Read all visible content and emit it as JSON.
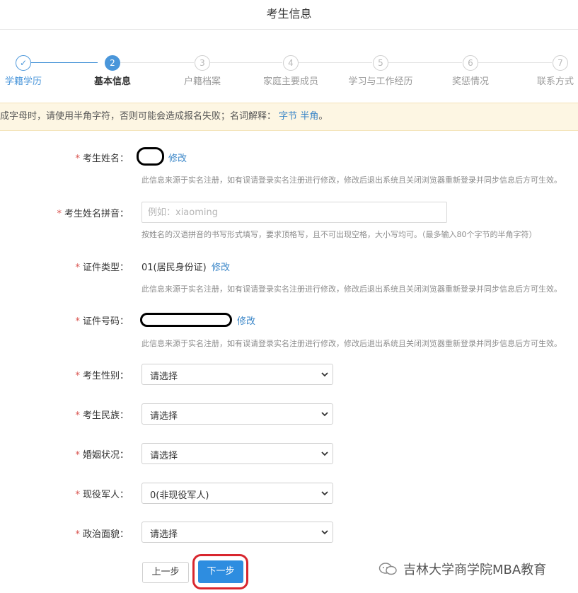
{
  "header": {
    "title": "考生信息"
  },
  "steps": [
    {
      "num": "✓",
      "label": "学籍学历",
      "state": "done"
    },
    {
      "num": "2",
      "label": "基本信息",
      "state": "active"
    },
    {
      "num": "3",
      "label": "户籍档案",
      "state": "todo"
    },
    {
      "num": "4",
      "label": "家庭主要成员",
      "state": "todo"
    },
    {
      "num": "5",
      "label": "学习与工作经历",
      "state": "todo"
    },
    {
      "num": "6",
      "label": "奖惩情况",
      "state": "todo"
    },
    {
      "num": "7",
      "label": "联系方式",
      "state": "todo"
    }
  ],
  "notice": {
    "text": "成字母时，请使用半角字符，否则可能会造成报名失败；名词解释：",
    "link1": "字节",
    "link2": "半角",
    "end": "。"
  },
  "form": {
    "required_mark": "*",
    "name": {
      "label": "考生姓名：",
      "edit": "修改",
      "hint": "此信息来源于实名注册，如有误请登录实名注册进行修改，修改后退出系统且关闭浏览器重新登录并同步信息后方可生效。"
    },
    "pinyin": {
      "label": "考生姓名拼音：",
      "placeholder": "例如：xiaoming",
      "hint": "按姓名的汉语拼音的书写形式填写，要求顶格写，且不可出现空格，大小写均可。（最多输入80个字节的半角字符）"
    },
    "id_type": {
      "label": "证件类型：",
      "value": "01(居民身份证)",
      "edit": "修改",
      "hint": "此信息来源于实名注册，如有误请登录实名注册进行修改，修改后退出系统且关闭浏览器重新登录并同步信息后方可生效。"
    },
    "id_number": {
      "label": "证件号码：",
      "edit": "修改",
      "hint": "此信息来源于实名注册，如有误请登录实名注册进行修改，修改后退出系统且关闭浏览器重新登录并同步信息后方可生效。"
    },
    "selects": [
      {
        "label": "考生性别：",
        "value": "请选择"
      },
      {
        "label": "考生民族：",
        "value": "请选择"
      },
      {
        "label": "婚姻状况：",
        "value": "请选择"
      },
      {
        "label": "现役军人：",
        "value": "0(非现役军人)"
      },
      {
        "label": "政治面貌：",
        "value": "请选择"
      }
    ]
  },
  "buttons": {
    "prev": "上一步",
    "next": "下一步"
  },
  "watermark": {
    "text": "吉林大学商学院MBA教育",
    "icon": "wechat-official-account-icon"
  },
  "colors": {
    "accent": "#2e8de0",
    "required": "#d9534f",
    "highlight_ring": "#d8262e",
    "notice_bg": "#fdf6e3"
  }
}
